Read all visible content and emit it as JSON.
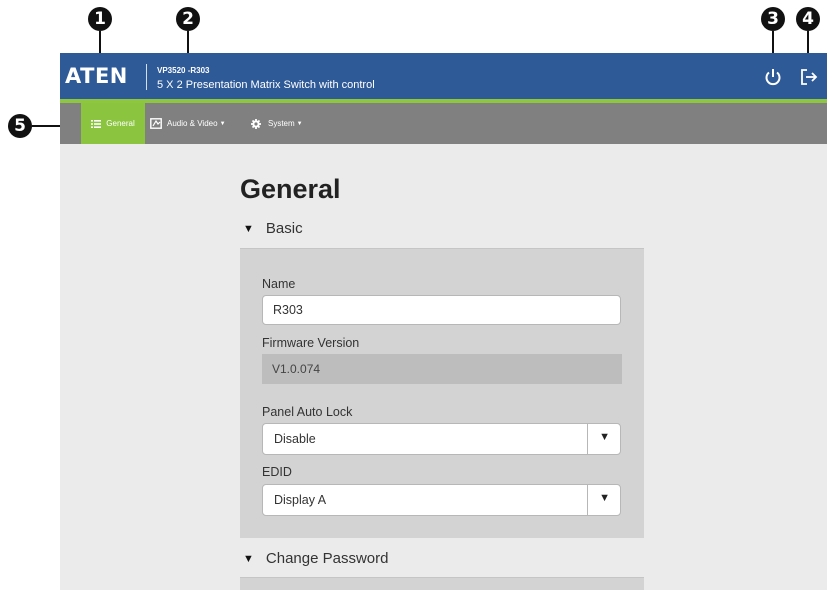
{
  "callouts": {
    "c1": "1",
    "c2": "2",
    "c3": "3",
    "c4": "4",
    "c5": "5"
  },
  "header": {
    "logo": "ATEN",
    "model": "VP3520 -R303",
    "product": "5 X 2 Presentation Matrix Switch with control",
    "icons": [
      "power-icon",
      "logout-icon"
    ]
  },
  "nav": {
    "general": "General",
    "audio_video": "Audio & Video",
    "system": "System"
  },
  "page": {
    "title": "General",
    "sections": {
      "basic": "Basic",
      "change_password": "Change Password"
    }
  },
  "form": {
    "name_label": "Name",
    "name_value": "R303",
    "firmware_label": "Firmware Version",
    "firmware_value": "V1.0.074",
    "panel_lock_label": "Panel Auto Lock",
    "panel_lock_value": "Disable",
    "edid_label": "EDID",
    "edid_value": "Display A"
  },
  "colors": {
    "header_bg": "#2e5a98",
    "accent_green": "#8bc53f",
    "navbar_bg": "#808080",
    "content_bg": "#ebebeb"
  }
}
